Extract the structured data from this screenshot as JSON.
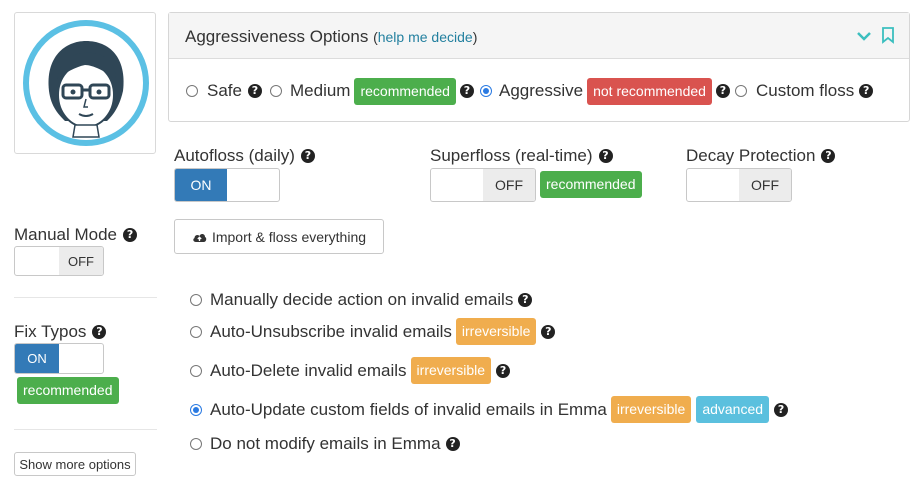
{
  "aggressiveness": {
    "title": "Aggressiveness Options",
    "help_open": "(",
    "help_link": "help me decide",
    "help_close": ")",
    "options": [
      {
        "label": "Safe",
        "selected": false
      },
      {
        "label": "Medium",
        "selected": false,
        "badge": "recommended"
      },
      {
        "label": "Aggressive",
        "selected": true,
        "badge": "not recommended"
      },
      {
        "label": "Custom floss",
        "selected": false
      }
    ]
  },
  "autofloss": {
    "label": "Autofloss (daily)",
    "state": "ON"
  },
  "superfloss": {
    "label": "Superfloss (real-time)",
    "state": "OFF",
    "badge": "recommended"
  },
  "decay": {
    "label": "Decay Protection",
    "state": "OFF"
  },
  "manual_mode": {
    "label": "Manual Mode",
    "state": "OFF"
  },
  "import_button": "Import & floss everything",
  "fix_typos": {
    "label": "Fix Typos",
    "state": "ON",
    "badge": "recommended"
  },
  "show_more": "Show more options",
  "invalid_options": [
    {
      "label": "Manually decide action on invalid emails",
      "selected": false,
      "badges": []
    },
    {
      "label": "Auto-Unsubscribe invalid emails",
      "selected": false,
      "badges": [
        "irreversible"
      ]
    },
    {
      "label": "Auto-Delete invalid emails",
      "selected": false,
      "badges": [
        "irreversible"
      ]
    },
    {
      "label": "Auto-Update custom fields of invalid emails in Emma",
      "selected": true,
      "badges": [
        "irreversible",
        "advanced"
      ]
    },
    {
      "label": "Do not modify emails in Emma",
      "selected": false,
      "badges": []
    }
  ],
  "colors": {
    "accent_blue": "#337ab7",
    "green": "#4cae4c",
    "red": "#d9534f",
    "orange": "#f0ad4e",
    "light_blue": "#5bc0de",
    "teal": "#3bbfbf"
  },
  "icons": {
    "collapse": "chevron-down-icon",
    "bookmark": "bookmark-icon",
    "help": "question-circle-icon",
    "cloud": "cloud-upload-icon"
  }
}
